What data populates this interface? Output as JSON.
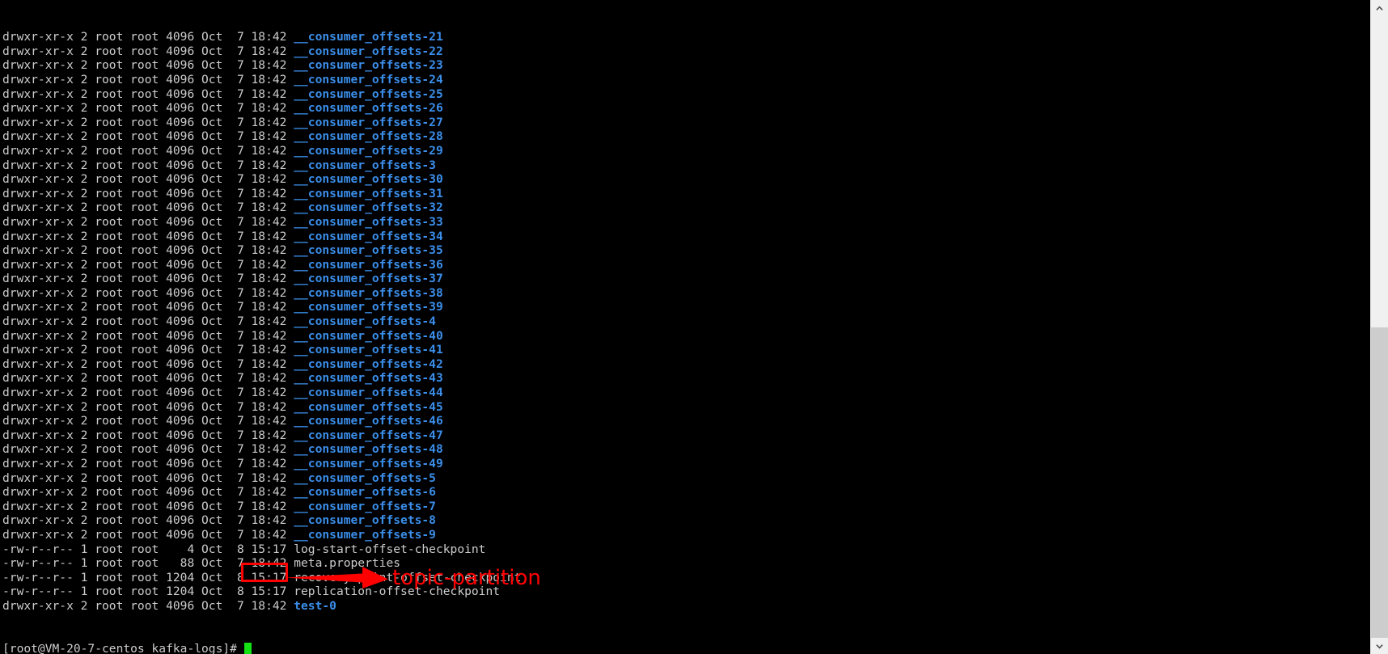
{
  "terminal": {
    "background_color": "#000000",
    "text_color": "#cccccc",
    "directory_color": "#3b8eea",
    "rows": [
      {
        "meta": "drwxr-xr-x 2 root root 4096 Oct  7 18:42 ",
        "name": "__consumer_offsets-21",
        "type": "dir"
      },
      {
        "meta": "drwxr-xr-x 2 root root 4096 Oct  7 18:42 ",
        "name": "__consumer_offsets-22",
        "type": "dir"
      },
      {
        "meta": "drwxr-xr-x 2 root root 4096 Oct  7 18:42 ",
        "name": "__consumer_offsets-23",
        "type": "dir"
      },
      {
        "meta": "drwxr-xr-x 2 root root 4096 Oct  7 18:42 ",
        "name": "__consumer_offsets-24",
        "type": "dir"
      },
      {
        "meta": "drwxr-xr-x 2 root root 4096 Oct  7 18:42 ",
        "name": "__consumer_offsets-25",
        "type": "dir"
      },
      {
        "meta": "drwxr-xr-x 2 root root 4096 Oct  7 18:42 ",
        "name": "__consumer_offsets-26",
        "type": "dir"
      },
      {
        "meta": "drwxr-xr-x 2 root root 4096 Oct  7 18:42 ",
        "name": "__consumer_offsets-27",
        "type": "dir"
      },
      {
        "meta": "drwxr-xr-x 2 root root 4096 Oct  7 18:42 ",
        "name": "__consumer_offsets-28",
        "type": "dir"
      },
      {
        "meta": "drwxr-xr-x 2 root root 4096 Oct  7 18:42 ",
        "name": "__consumer_offsets-29",
        "type": "dir"
      },
      {
        "meta": "drwxr-xr-x 2 root root 4096 Oct  7 18:42 ",
        "name": "__consumer_offsets-3",
        "type": "dir"
      },
      {
        "meta": "drwxr-xr-x 2 root root 4096 Oct  7 18:42 ",
        "name": "__consumer_offsets-30",
        "type": "dir"
      },
      {
        "meta": "drwxr-xr-x 2 root root 4096 Oct  7 18:42 ",
        "name": "__consumer_offsets-31",
        "type": "dir"
      },
      {
        "meta": "drwxr-xr-x 2 root root 4096 Oct  7 18:42 ",
        "name": "__consumer_offsets-32",
        "type": "dir"
      },
      {
        "meta": "drwxr-xr-x 2 root root 4096 Oct  7 18:42 ",
        "name": "__consumer_offsets-33",
        "type": "dir"
      },
      {
        "meta": "drwxr-xr-x 2 root root 4096 Oct  7 18:42 ",
        "name": "__consumer_offsets-34",
        "type": "dir"
      },
      {
        "meta": "drwxr-xr-x 2 root root 4096 Oct  7 18:42 ",
        "name": "__consumer_offsets-35",
        "type": "dir"
      },
      {
        "meta": "drwxr-xr-x 2 root root 4096 Oct  7 18:42 ",
        "name": "__consumer_offsets-36",
        "type": "dir"
      },
      {
        "meta": "drwxr-xr-x 2 root root 4096 Oct  7 18:42 ",
        "name": "__consumer_offsets-37",
        "type": "dir"
      },
      {
        "meta": "drwxr-xr-x 2 root root 4096 Oct  7 18:42 ",
        "name": "__consumer_offsets-38",
        "type": "dir"
      },
      {
        "meta": "drwxr-xr-x 2 root root 4096 Oct  7 18:42 ",
        "name": "__consumer_offsets-39",
        "type": "dir"
      },
      {
        "meta": "drwxr-xr-x 2 root root 4096 Oct  7 18:42 ",
        "name": "__consumer_offsets-4",
        "type": "dir"
      },
      {
        "meta": "drwxr-xr-x 2 root root 4096 Oct  7 18:42 ",
        "name": "__consumer_offsets-40",
        "type": "dir"
      },
      {
        "meta": "drwxr-xr-x 2 root root 4096 Oct  7 18:42 ",
        "name": "__consumer_offsets-41",
        "type": "dir"
      },
      {
        "meta": "drwxr-xr-x 2 root root 4096 Oct  7 18:42 ",
        "name": "__consumer_offsets-42",
        "type": "dir"
      },
      {
        "meta": "drwxr-xr-x 2 root root 4096 Oct  7 18:42 ",
        "name": "__consumer_offsets-43",
        "type": "dir"
      },
      {
        "meta": "drwxr-xr-x 2 root root 4096 Oct  7 18:42 ",
        "name": "__consumer_offsets-44",
        "type": "dir"
      },
      {
        "meta": "drwxr-xr-x 2 root root 4096 Oct  7 18:42 ",
        "name": "__consumer_offsets-45",
        "type": "dir"
      },
      {
        "meta": "drwxr-xr-x 2 root root 4096 Oct  7 18:42 ",
        "name": "__consumer_offsets-46",
        "type": "dir"
      },
      {
        "meta": "drwxr-xr-x 2 root root 4096 Oct  7 18:42 ",
        "name": "__consumer_offsets-47",
        "type": "dir"
      },
      {
        "meta": "drwxr-xr-x 2 root root 4096 Oct  7 18:42 ",
        "name": "__consumer_offsets-48",
        "type": "dir"
      },
      {
        "meta": "drwxr-xr-x 2 root root 4096 Oct  7 18:42 ",
        "name": "__consumer_offsets-49",
        "type": "dir"
      },
      {
        "meta": "drwxr-xr-x 2 root root 4096 Oct  7 18:42 ",
        "name": "__consumer_offsets-5",
        "type": "dir"
      },
      {
        "meta": "drwxr-xr-x 2 root root 4096 Oct  7 18:42 ",
        "name": "__consumer_offsets-6",
        "type": "dir"
      },
      {
        "meta": "drwxr-xr-x 2 root root 4096 Oct  7 18:42 ",
        "name": "__consumer_offsets-7",
        "type": "dir"
      },
      {
        "meta": "drwxr-xr-x 2 root root 4096 Oct  7 18:42 ",
        "name": "__consumer_offsets-8",
        "type": "dir"
      },
      {
        "meta": "drwxr-xr-x 2 root root 4096 Oct  7 18:42 ",
        "name": "__consumer_offsets-9",
        "type": "dir"
      },
      {
        "meta": "-rw-r--r-- 1 root root    4 Oct  8 15:17 ",
        "name": "log-start-offset-checkpoint",
        "type": "file"
      },
      {
        "meta": "-rw-r--r-- 1 root root   88 Oct  7 18:42 ",
        "name": "meta.properties",
        "type": "file"
      },
      {
        "meta": "-rw-r--r-- 1 root root 1204 Oct  8 15:17 ",
        "name": "recovery-point-offset-checkpoint",
        "type": "file"
      },
      {
        "meta": "-rw-r--r-- 1 root root 1204 Oct  8 15:17 ",
        "name": "replication-offset-checkpoint",
        "type": "file"
      },
      {
        "meta": "drwxr-xr-x 2 root root 4096 Oct  7 18:42 ",
        "name": "test-0",
        "type": "dir"
      }
    ],
    "prompt": "[root@VM-20-7-centos kafka-logs]# "
  },
  "annotation": {
    "label": "topic-partition",
    "color": "#ff0000",
    "highlighted_item": "test-0"
  },
  "scrollbar": {
    "up_arrow": "chevron-up-icon",
    "down_arrow": "chevron-down-icon",
    "track_color": "#f0f0f0",
    "thumb_color": "#cdcdcd"
  }
}
